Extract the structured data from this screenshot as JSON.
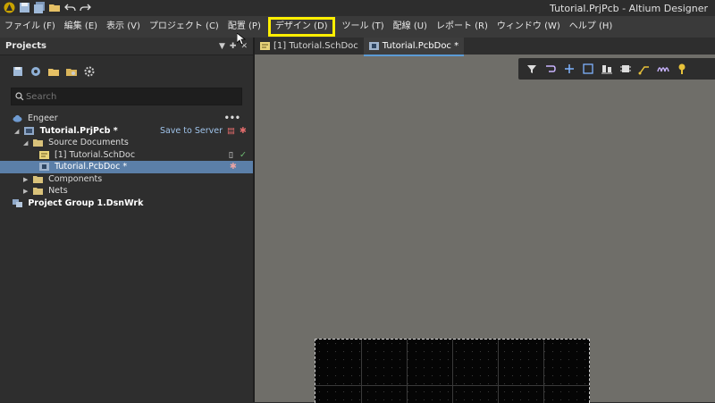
{
  "window": {
    "title": "Tutorial.PrjPcb - Altium Designer"
  },
  "menu": [
    {
      "label": "ファイル (F)"
    },
    {
      "label": "編集 (E)"
    },
    {
      "label": "表示 (V)"
    },
    {
      "label": "プロジェクト (C)"
    },
    {
      "label": "配置 (P)"
    },
    {
      "label": "デザイン (D)",
      "highlighted": true
    },
    {
      "label": "ツール (T)"
    },
    {
      "label": "配線 (U)"
    },
    {
      "label": "レポート (R)"
    },
    {
      "label": "ウィンドウ (W)"
    },
    {
      "label": "ヘルプ (H)"
    }
  ],
  "projects_panel": {
    "title": "Projects",
    "search_placeholder": "Search",
    "workspace": "Engeer",
    "project": "Tutorial.PrjPcb *",
    "save_to_server": "Save to Server",
    "source_documents": "Source Documents",
    "schdoc": "[1] Tutorial.SchDoc",
    "pcbdoc": "Tutorial.PcbDoc *",
    "components": "Components",
    "nets": "Nets",
    "project_group": "Project Group 1.DsnWrk"
  },
  "tabs": [
    {
      "label": "[1] Tutorial.SchDoc",
      "active": false
    },
    {
      "label": "Tutorial.PcbDoc *",
      "active": true
    }
  ],
  "colors": {
    "highlight": "#ffef00",
    "selection": "#5b7fa8",
    "canvas": "#6f6e69"
  }
}
